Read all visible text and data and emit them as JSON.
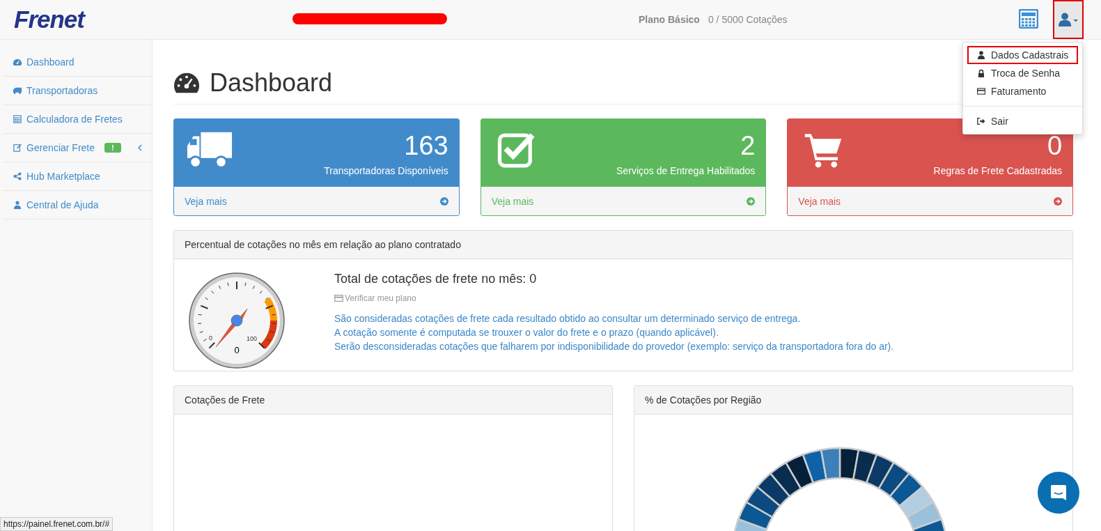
{
  "header": {
    "logo": "Frenet",
    "plan_name": "Plano Básico",
    "plan_usage": "0 / 5000 Cotações",
    "user_menu": {
      "expanded": true,
      "highlighted": true
    }
  },
  "sidebar": {
    "items": [
      {
        "label": "Dashboard"
      },
      {
        "label": "Transportadoras"
      },
      {
        "label": "Calculadora de Fretes"
      },
      {
        "label": "Gerenciar Frete",
        "badge": "!",
        "submenu": true
      },
      {
        "label": "Hub Marketplace"
      },
      {
        "label": "Central de Ajuda"
      }
    ]
  },
  "dropdown": {
    "groups": [
      [
        {
          "label": "Dados Cadastrais",
          "highlighted": true
        },
        {
          "label": "Troca de Senha",
          "highlighted": false
        },
        {
          "label": "Faturamento",
          "highlighted": false
        }
      ],
      [
        {
          "label": "Sair",
          "highlighted": false
        }
      ]
    ]
  },
  "page": {
    "title": "Dashboard"
  },
  "stat_cards": [
    {
      "value": "163",
      "label": "Transportadoras Disponíveis",
      "link": "Veja mais",
      "color": "#428bca"
    },
    {
      "value": "2",
      "label": "Serviços de Entrega Habilitados",
      "link": "Veja mais",
      "color": "#5cb85c"
    },
    {
      "value": "0",
      "label": "Regras de Frete Cadastradas",
      "link": "Veja mais",
      "color": "#d9534f"
    }
  ],
  "usage_panel": {
    "title": "Percentual de cotações no mês em relação ao plano contratado",
    "gauge": {
      "min_label": "0",
      "max_label": "100",
      "reading": "0"
    },
    "heading": "Total de cotações de frete no mês: 0",
    "plan_link": "Verificar meu plano",
    "notes": [
      "São consideradas cotações de frete cada resultado obtido ao consultar um determinado serviço de entrega.",
      "A cotação somente é computada se trouxer o valor do frete e o prazo (quando aplicável).",
      "Serão desconsideradas cotações que falharem por indisponibilidade do provedor (exemplo: serviço da transportadora fora do ar)."
    ]
  },
  "bottom_panels": [
    {
      "title": "Cotações de Frete",
      "kind": "empty"
    },
    {
      "title": "% de Cotações por Região",
      "kind": "donut"
    }
  ],
  "status_url": "https://painel.frenet.com.br/#"
}
